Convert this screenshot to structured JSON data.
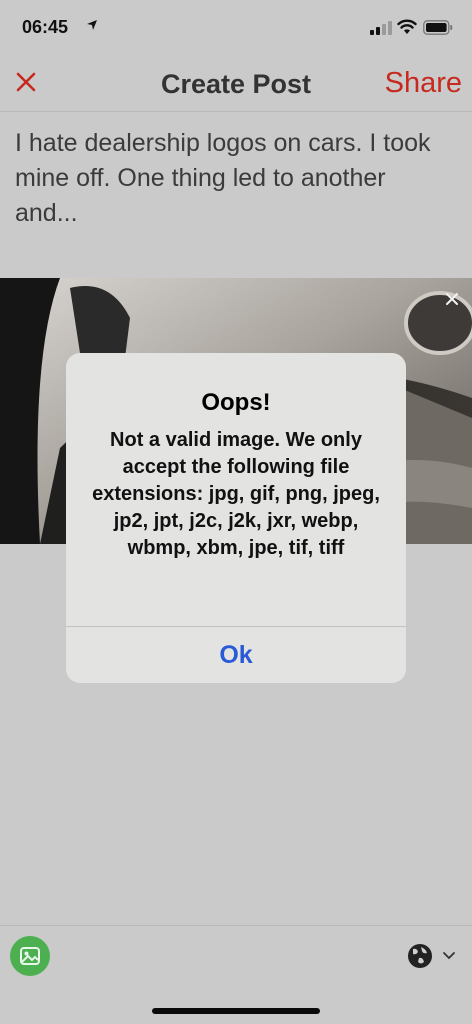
{
  "status_bar": {
    "time": "06:45"
  },
  "header": {
    "title": "Create Post",
    "share_label": "Share"
  },
  "post": {
    "text": "I hate dealership logos on cars. I took mine off. One thing led to another and..."
  },
  "alert": {
    "title": "Oops!",
    "message": "Not a valid image. We only accept the following file extensions: jpg, gif, png, jpeg, jp2, jpt, j2c, j2k, jxr, webp, wbmp, xbm, jpe, tif, tiff",
    "ok_label": "Ok"
  },
  "colors": {
    "accent": "#c62a1f",
    "link": "#2a5bd7",
    "image_button": "#4caf50"
  },
  "icons": [
    "location-arrow-icon",
    "signal-icon",
    "wifi-icon",
    "battery-icon",
    "close-icon",
    "remove-photo-icon",
    "image-icon",
    "globe-icon",
    "chevron-down-icon"
  ]
}
